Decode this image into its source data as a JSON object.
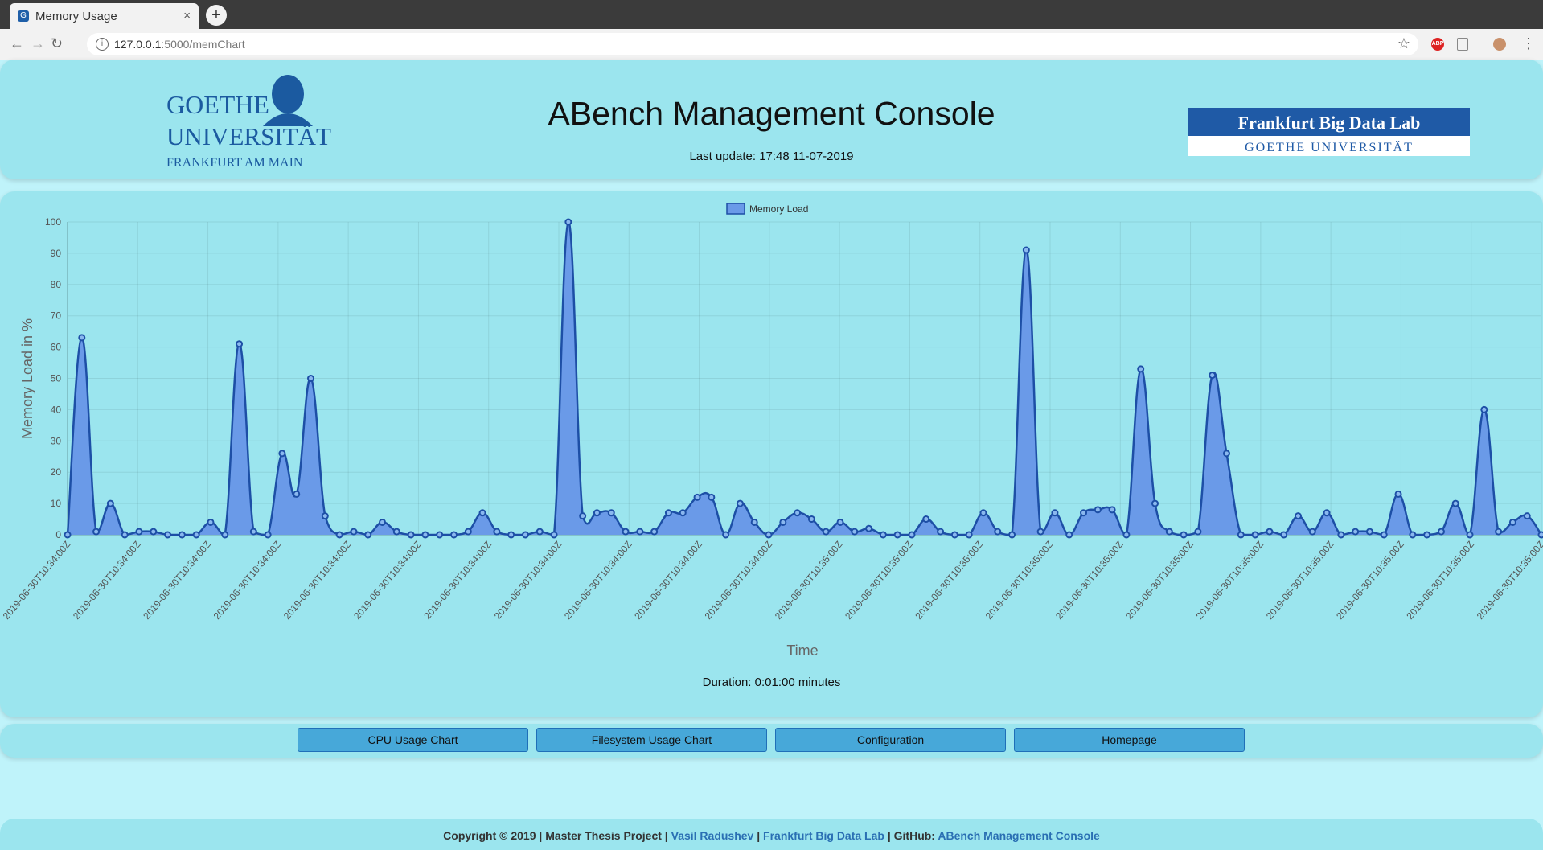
{
  "browser": {
    "tab_title": "Memory Usage",
    "tab_close": "×",
    "new_tab": "+",
    "url_host": "127.0.0.1",
    "url_path": ":5000/memChart"
  },
  "header": {
    "title": "ABench Management Console",
    "last_update": "Last update: 17:48 11-07-2019",
    "goethe_logo": [
      "GOETHE",
      "UNIVERSITÄT",
      "FRANKFURT AM MAIN"
    ],
    "fbdl_logo": [
      "Frankfurt Big Data Lab",
      "GOETHE UNIVERSITÄT"
    ]
  },
  "chart_data": {
    "type": "area",
    "legend": "Memory Load",
    "legend_position": "top",
    "ylabel": "Memory Load in %",
    "xlabel": "Time",
    "ylim": [
      0,
      100
    ],
    "yticks": [
      0,
      10,
      20,
      30,
      40,
      50,
      60,
      70,
      80,
      90,
      100
    ],
    "grid": true,
    "color": "#6a9ae8",
    "line_color": "#1d4fa6",
    "x_tick_labels": [
      "2019-06-30T10:34:00Z",
      "2019-06-30T10:34:00Z",
      "2019-06-30T10:34:00Z",
      "2019-06-30T10:34:00Z",
      "2019-06-30T10:34:00Z",
      "2019-06-30T10:34:00Z",
      "2019-06-30T10:34:00Z",
      "2019-06-30T10:34:00Z",
      "2019-06-30T10:34:00Z",
      "2019-06-30T10:34:00Z",
      "2019-06-30T10:34:00Z",
      "2019-06-30T10:35:00Z",
      "2019-06-30T10:35:00Z",
      "2019-06-30T10:35:00Z",
      "2019-06-30T10:35:00Z",
      "2019-06-30T10:35:00Z",
      "2019-06-30T10:35:00Z",
      "2019-06-30T10:35:00Z",
      "2019-06-30T10:35:00Z",
      "2019-06-30T10:35:00Z",
      "2019-06-30T10:35:00Z",
      "2019-06-30T10:35:00Z"
    ],
    "values": [
      0,
      63,
      1,
      10,
      0,
      1,
      1,
      0,
      0,
      0,
      4,
      0,
      61,
      1,
      0,
      26,
      13,
      50,
      6,
      0,
      1,
      0,
      4,
      1,
      0,
      0,
      0,
      0,
      1,
      7,
      1,
      0,
      0,
      1,
      0,
      100,
      6,
      7,
      7,
      1,
      1,
      1,
      7,
      7,
      12,
      12,
      0,
      10,
      4,
      0,
      4,
      7,
      5,
      1,
      4,
      1,
      2,
      0,
      0,
      0,
      5,
      1,
      0,
      0,
      7,
      1,
      0,
      91,
      1,
      7,
      0,
      7,
      8,
      8,
      0,
      53,
      10,
      1,
      0,
      1,
      51,
      26,
      0,
      0,
      1,
      0,
      6,
      1,
      7,
      0,
      1,
      1,
      0,
      13,
      0,
      0,
      1,
      10,
      0,
      40,
      1,
      4,
      6,
      0
    ]
  },
  "duration": "Duration: 0:01:00 minutes",
  "nav_buttons": [
    "CPU Usage Chart",
    "Filesystem Usage Chart",
    "Configuration",
    "Homepage"
  ],
  "footer": {
    "prefix": "Copyright © 2019 | Master Thesis Project | ",
    "author": "Vasil Radushev",
    "sep": " | ",
    "lab": "Frankfurt Big Data Lab",
    "github_label": " | GitHub: ",
    "repo": "ABench Management Console"
  }
}
